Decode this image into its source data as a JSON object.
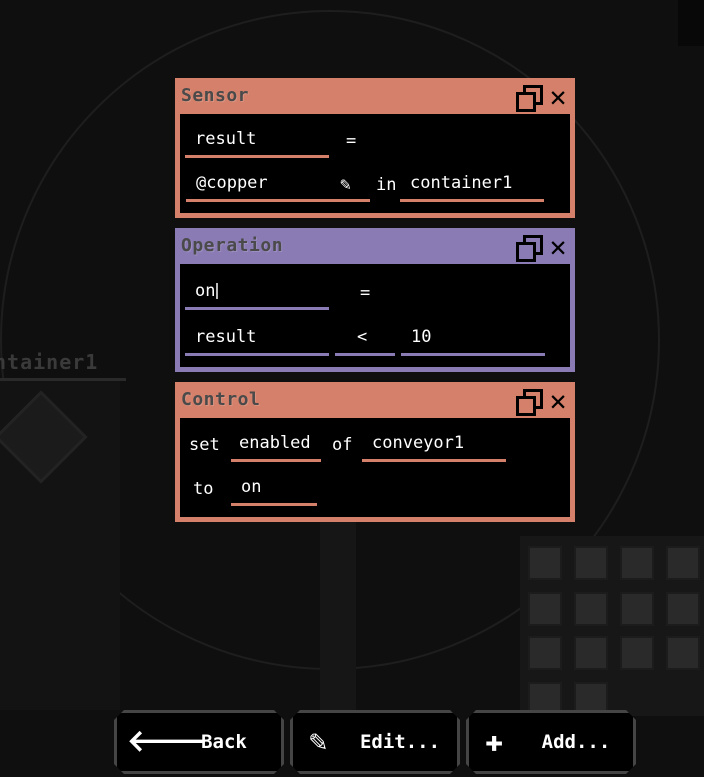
{
  "colors": {
    "sensor": "#d4806a",
    "operation": "#8b7bb5",
    "control": "#d4806a",
    "button_border": "#454545"
  },
  "sensor": {
    "title": "Sensor",
    "result": "result",
    "equals": "=",
    "item": "@copper",
    "in_label": "in",
    "target": "container1"
  },
  "operation": {
    "title": "Operation",
    "output": "on",
    "equals": "=",
    "left": "result",
    "op": "<",
    "right": "10"
  },
  "control": {
    "title": "Control",
    "set_label": "set",
    "property": "enabled",
    "of_label": "of",
    "target": "conveyor1",
    "to_label": "to",
    "value": "on"
  },
  "background": {
    "label": "ntainer1"
  },
  "buttons": {
    "back": "Back",
    "edit": "Edit...",
    "add": "Add..."
  }
}
